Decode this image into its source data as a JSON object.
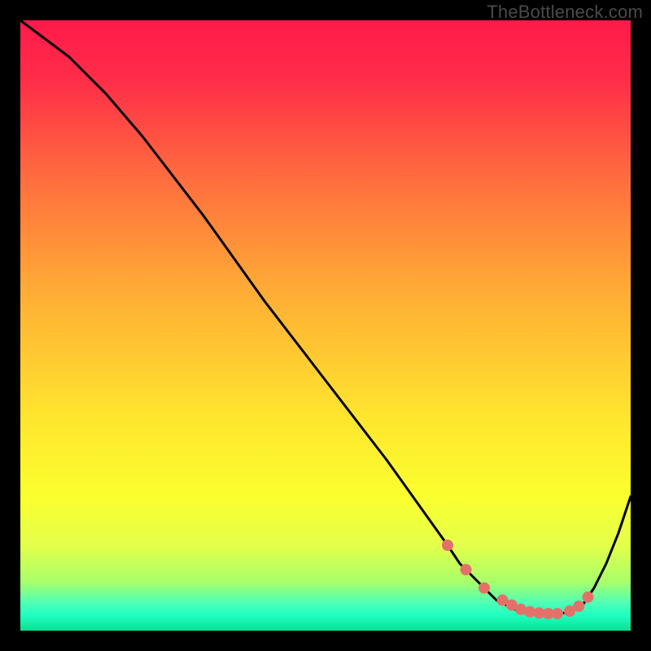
{
  "watermark": "TheBottleneck.com",
  "colors": {
    "frame": "#000000",
    "line": "#000000",
    "dots": "#e47169",
    "gradient_stops": [
      {
        "offset": 0.0,
        "color": "#ff1a4b"
      },
      {
        "offset": 0.1,
        "color": "#ff2e48"
      },
      {
        "offset": 0.25,
        "color": "#ff6a3f"
      },
      {
        "offset": 0.45,
        "color": "#ffae35"
      },
      {
        "offset": 0.65,
        "color": "#ffe52e"
      },
      {
        "offset": 0.78,
        "color": "#fbff2e"
      },
      {
        "offset": 0.86,
        "color": "#e4ff4a"
      },
      {
        "offset": 0.92,
        "color": "#a8ff6a"
      },
      {
        "offset": 0.955,
        "color": "#4dffb7"
      },
      {
        "offset": 0.975,
        "color": "#1effc0"
      },
      {
        "offset": 1.0,
        "color": "#0bdf93"
      }
    ]
  },
  "chart_data": {
    "type": "line",
    "title": "",
    "xlabel": "",
    "ylabel": "",
    "xlim": [
      0,
      100
    ],
    "ylim": [
      0,
      100
    ],
    "series": [
      {
        "name": "curve",
        "x": [
          0,
          4,
          8,
          10,
          14,
          20,
          30,
          40,
          50,
          60,
          65,
          70,
          72,
          74,
          76,
          78,
          80,
          82,
          84,
          86,
          88,
          90,
          92,
          94,
          96,
          98,
          100
        ],
        "y": [
          100,
          97,
          94,
          92,
          88,
          81,
          68,
          54,
          41,
          28,
          21,
          14,
          11,
          9,
          7,
          5,
          4,
          3,
          2.8,
          2.8,
          2.8,
          3,
          4,
          7,
          11,
          16,
          22
        ]
      }
    ],
    "markers": {
      "name": "dots",
      "x": [
        70,
        73,
        76,
        79,
        80.5,
        82,
        83.5,
        85,
        86.5,
        88,
        90,
        91.5,
        93
      ],
      "y": [
        14,
        10,
        7,
        5,
        4.2,
        3.5,
        3.1,
        2.9,
        2.8,
        2.8,
        3.2,
        4.0,
        5.5
      ]
    }
  }
}
